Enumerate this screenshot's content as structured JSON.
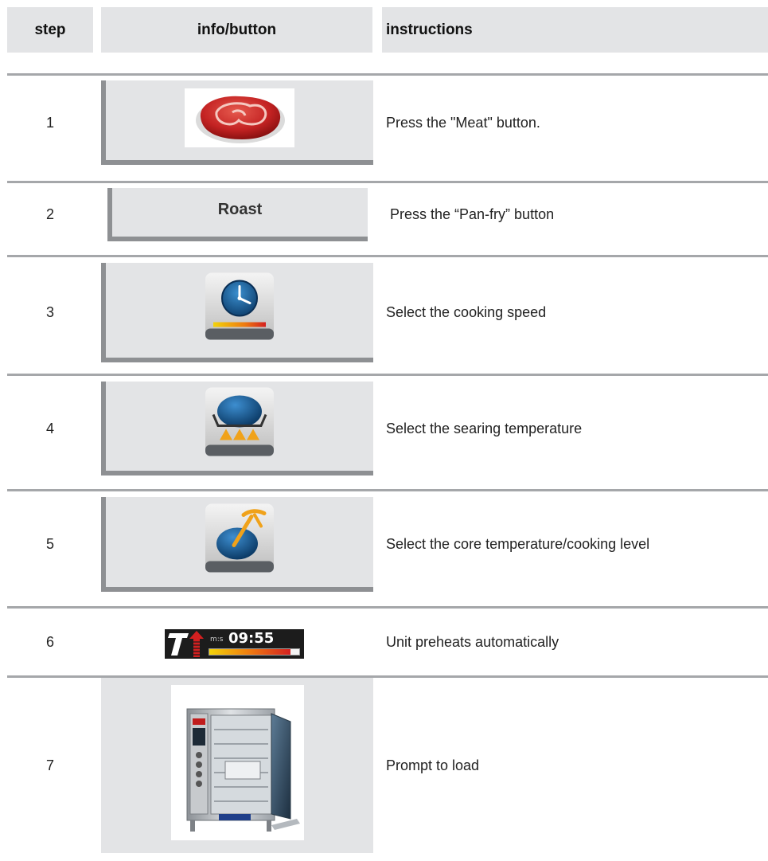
{
  "header": {
    "col_step": "step",
    "col_info": "info/button",
    "col_instructions": "instructions"
  },
  "rows": [
    {
      "step": "1",
      "instruction": "Press the \"Meat\" button.",
      "icon": "meat-icon"
    },
    {
      "step": "2",
      "instruction": "Press the “Pan-fry” button",
      "button_label": "Roast"
    },
    {
      "step": "3",
      "instruction": "Select the cooking speed",
      "icon": "clock-speed-icon"
    },
    {
      "step": "4",
      "instruction": "Select the searing temperature",
      "icon": "searing-pan-icon"
    },
    {
      "step": "5",
      "instruction": "Select the core temperature/cooking level",
      "icon": "core-probe-icon"
    },
    {
      "step": "6",
      "instruction": "Unit preheats automatically",
      "display_unit": "m:s",
      "display_time": "09:55",
      "preheat_progress": 0.9
    },
    {
      "step": "7",
      "instruction": "Prompt to load",
      "icon": "combi-oven-image"
    }
  ]
}
